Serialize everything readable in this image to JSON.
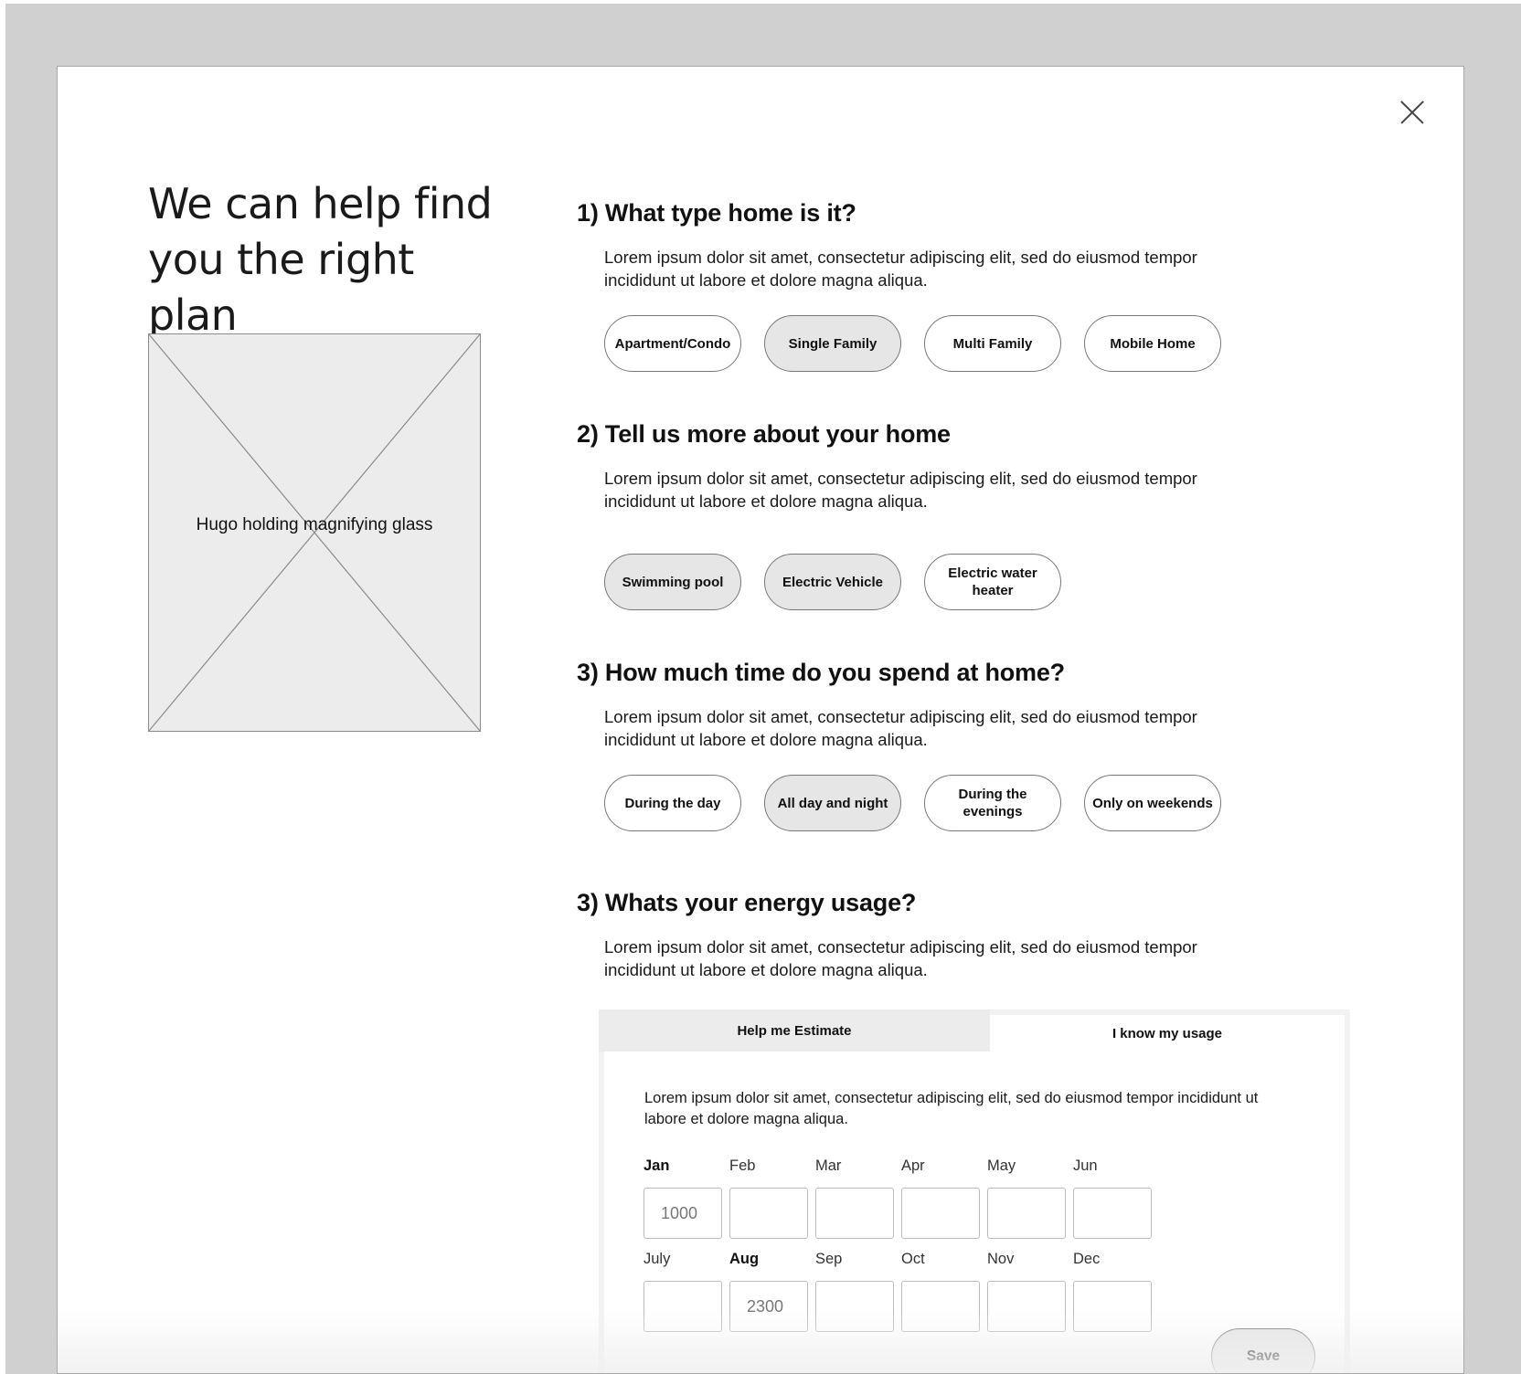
{
  "hero": {
    "title": "We can help find you the right plan",
    "image_label": "Hugo holding magnifying glass"
  },
  "close_icon": "close-icon",
  "questions": [
    {
      "title": "1) What type home is it?",
      "description": "Lorem ipsum dolor sit amet, consectetur adipiscing elit, sed do eiusmod tempor incididunt ut labore et dolore magna aliqua.",
      "options": [
        {
          "label": "Apartment/Condo",
          "selected": false
        },
        {
          "label": "Single Family",
          "selected": true
        },
        {
          "label": "Multi Family",
          "selected": false
        },
        {
          "label": "Mobile Home",
          "selected": false
        }
      ]
    },
    {
      "title": "2) Tell us more about your home",
      "description": "Lorem ipsum dolor sit amet, consectetur adipiscing elit, sed do eiusmod tempor incididunt ut labore et dolore magna aliqua.",
      "options": [
        {
          "label": "Swimming pool",
          "selected": true
        },
        {
          "label": "Electric Vehicle",
          "selected": true
        },
        {
          "label": "Electric water heater",
          "selected": false
        }
      ]
    },
    {
      "title": "3) How much time do you spend at home?",
      "description": "Lorem ipsum dolor sit amet, consectetur adipiscing elit, sed do eiusmod tempor incididunt ut labore et dolore magna aliqua.",
      "options": [
        {
          "label": "During the day",
          "selected": false
        },
        {
          "label": "All day and night",
          "selected": true
        },
        {
          "label": "During the evenings",
          "selected": false
        },
        {
          "label": "Only on weekends",
          "selected": false
        }
      ]
    },
    {
      "title": "3) Whats your energy usage?",
      "description": "Lorem ipsum dolor sit amet, consectetur adipiscing elit, sed do eiusmod tempor incididunt ut labore et dolore magna aliqua."
    }
  ],
  "usage": {
    "tabs": [
      {
        "label": "Help me Estimate",
        "active": false
      },
      {
        "label": "I know my usage",
        "active": true
      }
    ],
    "description": "Lorem ipsum dolor sit amet, consectetur adipiscing elit, sed do eiusmod tempor incididunt ut labore et dolore magna aliqua.",
    "months": [
      {
        "label": "Jan",
        "value": "1000",
        "bold": true
      },
      {
        "label": "Feb",
        "value": "",
        "bold": false
      },
      {
        "label": "Mar",
        "value": "",
        "bold": false
      },
      {
        "label": "Apr",
        "value": "",
        "bold": false
      },
      {
        "label": "May",
        "value": "",
        "bold": false
      },
      {
        "label": "Jun",
        "value": "",
        "bold": false
      },
      {
        "label": "July",
        "value": "",
        "bold": false
      },
      {
        "label": "Aug",
        "value": "2300",
        "bold": true
      },
      {
        "label": "Sep",
        "value": "",
        "bold": false
      },
      {
        "label": "Oct",
        "value": "",
        "bold": false
      },
      {
        "label": "Nov",
        "value": "",
        "bold": false
      },
      {
        "label": "Dec",
        "value": "",
        "bold": false
      }
    ],
    "save_label": "Save"
  }
}
